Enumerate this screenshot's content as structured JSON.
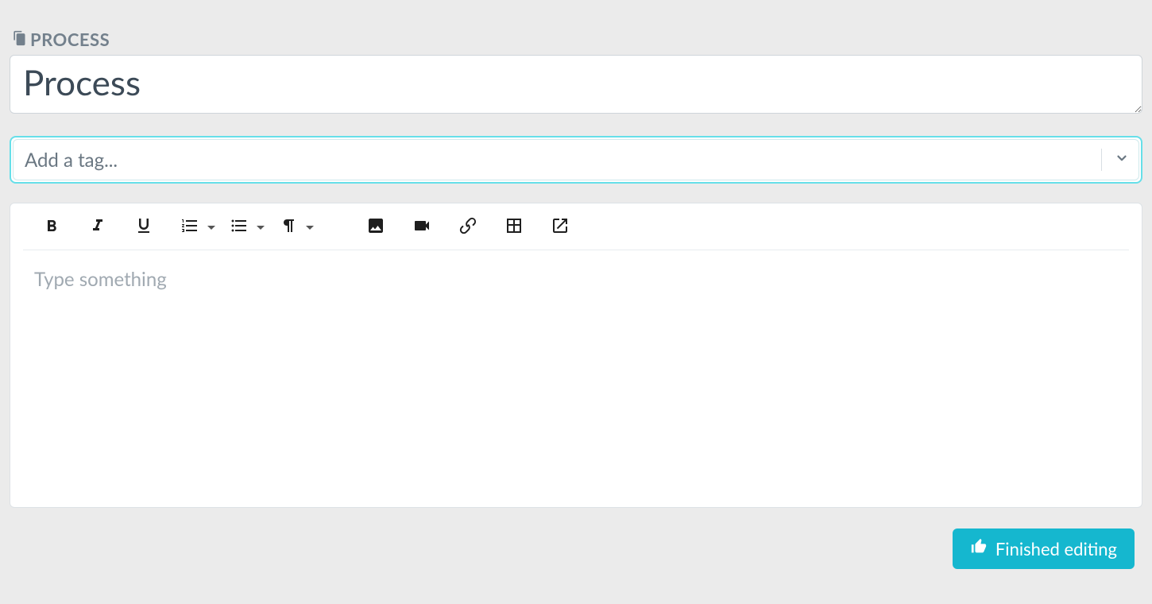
{
  "section": {
    "label": "PROCESS"
  },
  "title": {
    "value": "Process"
  },
  "tag": {
    "placeholder": "Add a tag..."
  },
  "editor": {
    "placeholder": "Type something",
    "toolbar": {
      "bold": "bold",
      "italic": "italic",
      "underline": "underline",
      "ordered_list": "ordered-list",
      "unordered_list": "unordered-list",
      "paragraph": "paragraph-format",
      "image": "insert-image",
      "video": "insert-video",
      "link": "insert-link",
      "table": "insert-table",
      "external": "open-external"
    }
  },
  "footer": {
    "finish_label": "Finished editing"
  },
  "colors": {
    "accent": "#15b7cf",
    "focus_ring": "#66dfe9"
  }
}
